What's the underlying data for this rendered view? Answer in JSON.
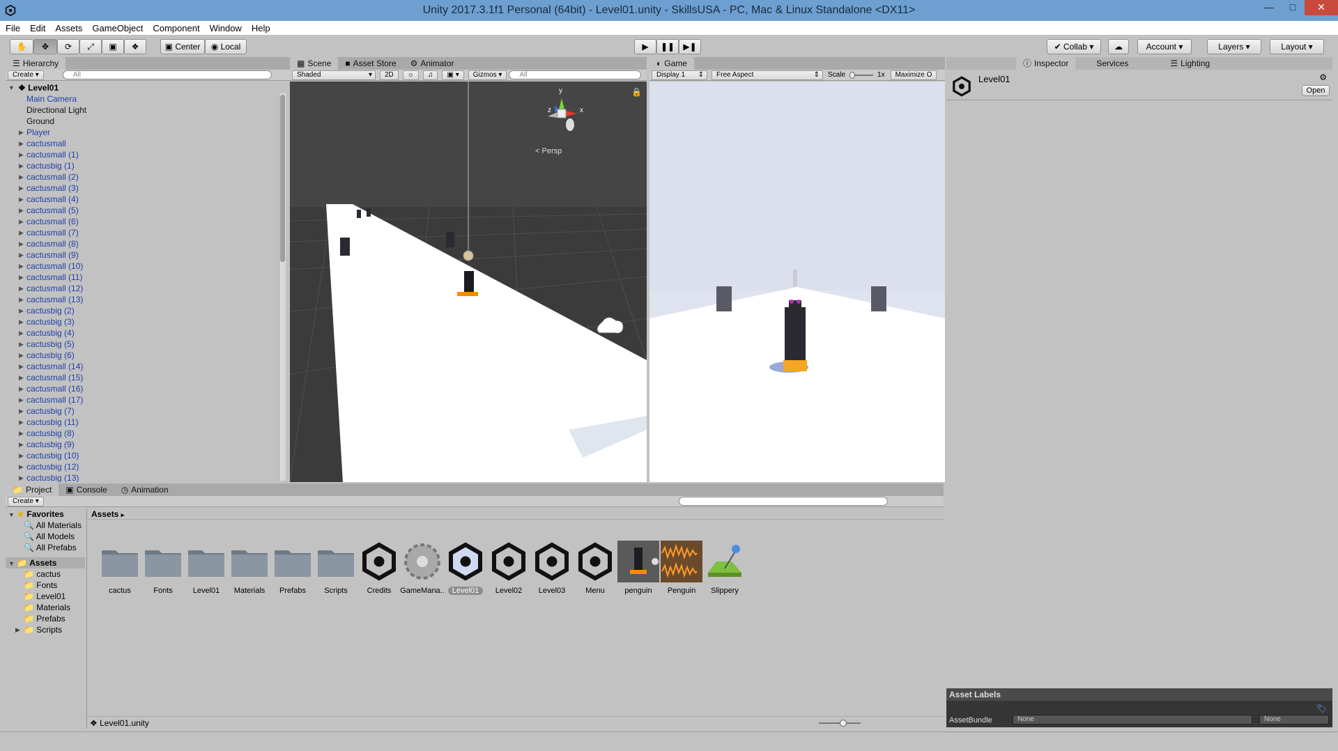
{
  "window": {
    "title": "Unity 2017.3.1f1 Personal (64bit) - Level01.unity - SkillsUSA - PC, Mac & Linux Standalone <DX11>"
  },
  "menu": [
    "File",
    "Edit",
    "Assets",
    "GameObject",
    "Component",
    "Window",
    "Help"
  ],
  "toolbar": {
    "pivot": "Center",
    "space": "Local",
    "collab": "Collab",
    "account": "Account",
    "layers": "Layers",
    "layout": "Layout"
  },
  "hierarchy": {
    "tab": "Hierarchy",
    "create": "Create",
    "search_placeholder": "All",
    "scene": "Level01",
    "items": [
      {
        "label": "Main Camera",
        "arrow": false,
        "plain": false
      },
      {
        "label": "Directional Light",
        "arrow": false,
        "plain": true
      },
      {
        "label": "Ground",
        "arrow": false,
        "plain": true
      },
      {
        "label": "Player",
        "arrow": true,
        "plain": false
      },
      {
        "label": "cactusmall",
        "arrow": true,
        "plain": false
      },
      {
        "label": "cactusmall (1)",
        "arrow": true,
        "plain": false
      },
      {
        "label": "cactusbig (1)",
        "arrow": true,
        "plain": false
      },
      {
        "label": "cactusmall (2)",
        "arrow": true,
        "plain": false
      },
      {
        "label": "cactusmall (3)",
        "arrow": true,
        "plain": false
      },
      {
        "label": "cactusmall (4)",
        "arrow": true,
        "plain": false
      },
      {
        "label": "cactusmall (5)",
        "arrow": true,
        "plain": false
      },
      {
        "label": "cactusmall (6)",
        "arrow": true,
        "plain": false
      },
      {
        "label": "cactusmall (7)",
        "arrow": true,
        "plain": false
      },
      {
        "label": "cactusmall (8)",
        "arrow": true,
        "plain": false
      },
      {
        "label": "cactusmall (9)",
        "arrow": true,
        "plain": false
      },
      {
        "label": "cactusmall (10)",
        "arrow": true,
        "plain": false
      },
      {
        "label": "cactusmall (11)",
        "arrow": true,
        "plain": false
      },
      {
        "label": "cactusmall (12)",
        "arrow": true,
        "plain": false
      },
      {
        "label": "cactusmall (13)",
        "arrow": true,
        "plain": false
      },
      {
        "label": "cactusbig (2)",
        "arrow": true,
        "plain": false
      },
      {
        "label": "cactusbig (3)",
        "arrow": true,
        "plain": false
      },
      {
        "label": "cactusbig (4)",
        "arrow": true,
        "plain": false
      },
      {
        "label": "cactusbig (5)",
        "arrow": true,
        "plain": false
      },
      {
        "label": "cactusbig (6)",
        "arrow": true,
        "plain": false
      },
      {
        "label": "cactusmall (14)",
        "arrow": true,
        "plain": false
      },
      {
        "label": "cactusmall (15)",
        "arrow": true,
        "plain": false
      },
      {
        "label": "cactusmall (16)",
        "arrow": true,
        "plain": false
      },
      {
        "label": "cactusmall (17)",
        "arrow": true,
        "plain": false
      },
      {
        "label": "cactusbig (7)",
        "arrow": true,
        "plain": false
      },
      {
        "label": "cactusbig (11)",
        "arrow": true,
        "plain": false
      },
      {
        "label": "cactusbig (8)",
        "arrow": true,
        "plain": false
      },
      {
        "label": "cactusbig (9)",
        "arrow": true,
        "plain": false
      },
      {
        "label": "cactusbig (10)",
        "arrow": true,
        "plain": false
      },
      {
        "label": "cactusbig (12)",
        "arrow": true,
        "plain": false
      },
      {
        "label": "cactusbig (13)",
        "arrow": true,
        "plain": false
      }
    ]
  },
  "scene": {
    "tabs": [
      "Scene",
      "Asset Store",
      "Animator"
    ],
    "shading": "Shaded",
    "mode2d": "2D",
    "gizmos": "Gizmos",
    "search_placeholder": "All",
    "persp": "Persp",
    "axis_y": "y",
    "axis_x": "x",
    "axis_z": "z"
  },
  "game": {
    "tab": "Game",
    "display": "Display 1",
    "aspect": "Free Aspect",
    "scale_label": "Scale",
    "scale_value": "1x",
    "maximize": "Maximize O"
  },
  "inspector": {
    "tabs": [
      "Inspector",
      "Services",
      "Lighting"
    ],
    "object": "Level01",
    "open": "Open",
    "asset_labels": "Asset Labels",
    "assetbundle_label": "AssetBundle",
    "bundle": "None",
    "variant": "None"
  },
  "project": {
    "tabs": [
      "Project",
      "Console",
      "Animation"
    ],
    "create": "Create",
    "favorites": "Favorites",
    "fav_items": [
      "All Materials",
      "All Models",
      "All Prefabs"
    ],
    "assets_root": "Assets",
    "folders": [
      "cactus",
      "Fonts",
      "Level01",
      "Materials",
      "Prefabs",
      "Scripts"
    ],
    "breadcrumb": "Assets",
    "items": [
      {
        "label": "cactus",
        "kind": "folder"
      },
      {
        "label": "Fonts",
        "kind": "folder"
      },
      {
        "label": "Level01",
        "kind": "folder"
      },
      {
        "label": "Materials",
        "kind": "folder"
      },
      {
        "label": "Prefabs",
        "kind": "folder"
      },
      {
        "label": "Scripts",
        "kind": "folder"
      },
      {
        "label": "Credits",
        "kind": "unity"
      },
      {
        "label": "GameMana..",
        "kind": "gear"
      },
      {
        "label": "Level01",
        "kind": "unity-sel"
      },
      {
        "label": "Level02",
        "kind": "unity"
      },
      {
        "label": "Level03",
        "kind": "unity"
      },
      {
        "label": "Menu",
        "kind": "unity"
      },
      {
        "label": "penguin",
        "kind": "model"
      },
      {
        "label": "Penguin",
        "kind": "audio"
      },
      {
        "label": "Slippery",
        "kind": "physmat"
      }
    ],
    "footer": "Level01.unity"
  }
}
